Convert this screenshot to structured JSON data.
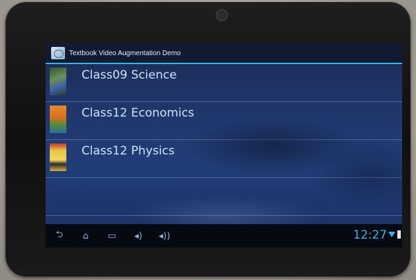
{
  "app": {
    "title": "Textbook Video Augmentation Demo"
  },
  "books": [
    {
      "label": "Class09 Science",
      "thumb_icon": "science-book-cover-icon"
    },
    {
      "label": "Class12 Economics",
      "thumb_icon": "economics-book-cover-icon"
    },
    {
      "label": "Class12 Physics",
      "thumb_icon": "physics-book-cover-icon"
    }
  ],
  "navbar": {
    "back_glyph": "⮌",
    "home_glyph": "⌂",
    "recents_glyph": "▭",
    "vol_down_glyph": "◂)",
    "vol_up_glyph": "◂))"
  },
  "status": {
    "time": "12:27"
  },
  "colors": {
    "accent": "#33b5e5",
    "list_text": "#cfe3ff"
  }
}
